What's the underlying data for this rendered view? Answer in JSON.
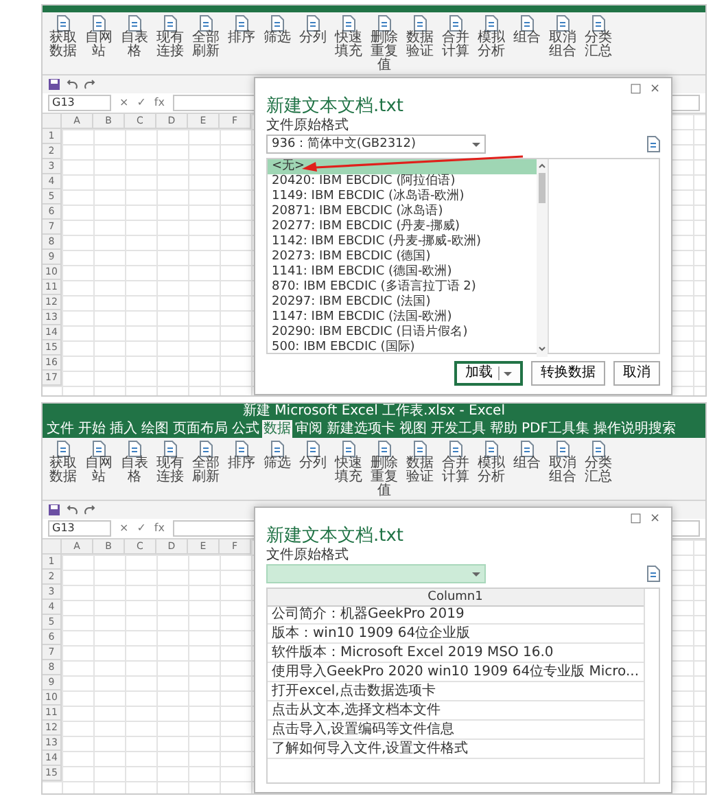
{
  "panels": [
    {
      "kind": "cropped",
      "ribbon_buttons": [
        "获取数据",
        "自网站",
        "自表格",
        "现有连接",
        "全部刷新",
        "排序",
        "筛选",
        "分列",
        "快速填充",
        "删除重复值",
        "数据验证",
        "合并计算",
        "模拟分析",
        "组合",
        "取消组合",
        "分类汇总"
      ],
      "name_box": "G13",
      "formula_symbols": [
        "×",
        "✓",
        "fx"
      ],
      "grid": {
        "columns": [
          "A",
          "B",
          "C",
          "D",
          "E",
          "F"
        ],
        "rows": [
          "1",
          "2",
          "3",
          "4",
          "5",
          "6",
          "7",
          "8",
          "9",
          "10",
          "11",
          "12",
          "13",
          "14",
          "15",
          "16",
          "17"
        ]
      },
      "dialog": {
        "kind": "encoding_list",
        "controls": [
          "□",
          "×"
        ],
        "title": "新建文本文档.txt",
        "encoding_label": "文件原始格式",
        "encoding_value": "936 : 简体中文(GB2312)",
        "focused": false,
        "items": [
          {
            "label": "<无>",
            "selected": true
          },
          {
            "label": "20420: IBM EBCDIC (阿拉伯语)",
            "selected": false
          },
          {
            "label": "1149: IBM EBCDIC (冰岛语-欧洲)",
            "selected": false
          },
          {
            "label": "20871: IBM EBCDIC (冰岛语)",
            "selected": false
          },
          {
            "label": "20277: IBM EBCDIC (丹麦-挪威)",
            "selected": false
          },
          {
            "label": "1142: IBM EBCDIC (丹麦-挪威-欧洲)",
            "selected": false
          },
          {
            "label": "20273: IBM EBCDIC (德国)",
            "selected": false
          },
          {
            "label": "1141: IBM EBCDIC (德国-欧洲)",
            "selected": false
          },
          {
            "label": "870: IBM EBCDIC (多语言拉丁语 2)",
            "selected": false
          },
          {
            "label": "20297: IBM EBCDIC (法国)",
            "selected": false
          },
          {
            "label": "1147: IBM EBCDIC (法国-欧洲)",
            "selected": false
          },
          {
            "label": "20290: IBM EBCDIC (日语片假名)",
            "selected": false
          },
          {
            "label": "500: IBM EBCDIC (国际)",
            "selected": false
          }
        ],
        "buttons": [
          {
            "label": "加载",
            "default": true,
            "split": true
          },
          {
            "label": "转换数据",
            "default": false,
            "split": false
          },
          {
            "label": "取消",
            "default": false,
            "split": false
          }
        ]
      }
    },
    {
      "kind": "full",
      "title": "新建 Microsoft Excel 工作表.xlsx - Excel",
      "tabs": [
        {
          "label": "文件",
          "selected": false
        },
        {
          "label": "开始",
          "selected": false
        },
        {
          "label": "插入",
          "selected": false
        },
        {
          "label": "绘图",
          "selected": false
        },
        {
          "label": "页面布局",
          "selected": false
        },
        {
          "label": "公式",
          "selected": false
        },
        {
          "label": "数据",
          "selected": true
        },
        {
          "label": "审阅",
          "selected": false
        },
        {
          "label": "新建选项卡",
          "selected": false
        },
        {
          "label": "视图",
          "selected": false
        },
        {
          "label": "开发工具",
          "selected": false
        },
        {
          "label": "帮助",
          "selected": false
        },
        {
          "label": "PDF工具集",
          "selected": false
        },
        {
          "label": "操作说明搜索",
          "selected": false
        }
      ],
      "ribbon_buttons": [
        "获取数据",
        "自网站",
        "自表格",
        "现有连接",
        "全部刷新",
        "排序",
        "筛选",
        "分列",
        "快速填充",
        "删除重复值",
        "数据验证",
        "合并计算",
        "模拟分析",
        "组合",
        "取消组合",
        "分类汇总"
      ],
      "name_box": "G13",
      "formula_symbols": [
        "×",
        "✓",
        "fx"
      ],
      "grid": {
        "columns": [
          "A",
          "B",
          "C",
          "D",
          "E",
          "F"
        ],
        "rows": [
          "1",
          "2",
          "3",
          "4",
          "5",
          "6",
          "7",
          "8",
          "9",
          "10",
          "11",
          "12",
          "13",
          "14",
          "15"
        ]
      },
      "dialog": {
        "kind": "preview_table",
        "controls": [
          "□",
          "×"
        ],
        "title": "新建文本文档.txt",
        "encoding_label": "文件原始格式",
        "focused": true,
        "header": "Column1",
        "rows": [
          "公司简介：机器GeekPro 2019",
          "版本：win10 1909 64位企业版",
          "软件版本：Microsoft Excel 2019 MSO 16.0",
          "使用导入GeekPro 2020 win10 1909 64位专业版 Micro...",
          "打开excel,点击数据选项卡",
          "点击从文本,选择文档本文件",
          "点击导入,设置编码等文件信息",
          "了解如何导入文件,设置文件格式"
        ]
      }
    }
  ]
}
